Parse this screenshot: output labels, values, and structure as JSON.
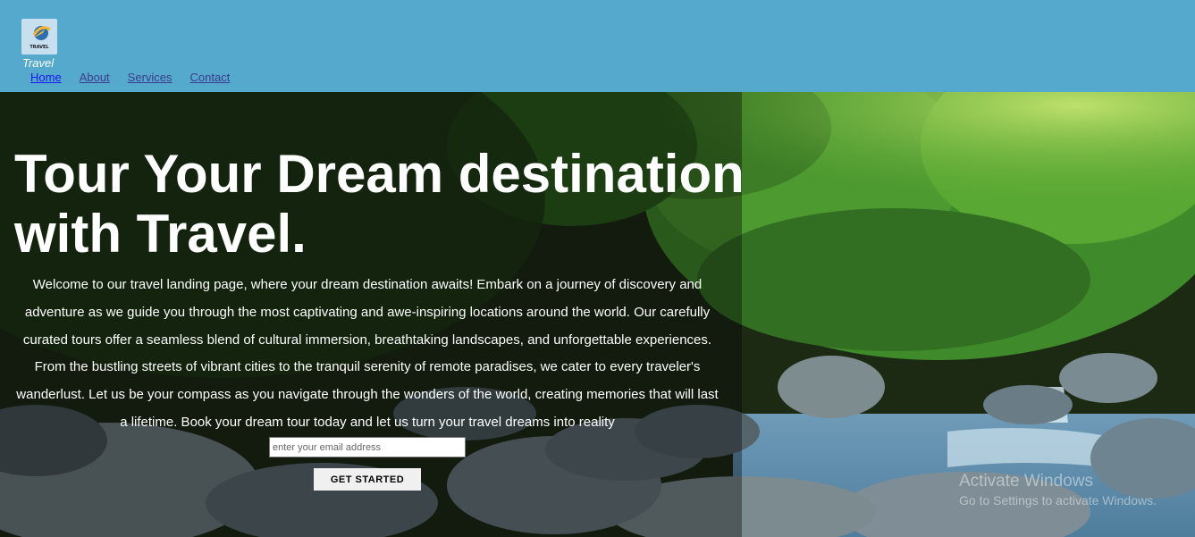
{
  "header": {
    "brand": "Travel",
    "logo_icon": "travel-logo-icon",
    "nav": [
      {
        "label": "Home",
        "active": true
      },
      {
        "label": "About",
        "active": false
      },
      {
        "label": "Services",
        "active": false
      },
      {
        "label": "Contact",
        "active": false
      }
    ]
  },
  "hero": {
    "title": "Tour Your Dream destination with Travel.",
    "description": "Welcome to our travel landing page, where your dream destination awaits! Embark on a journey of discovery and adventure as we guide you through the most captivating and awe-inspiring locations around the world. Our carefully curated tours offer a seamless blend of cultural immersion, breathtaking landscapes, and unforgettable experiences. From the bustling streets of vibrant cities to the tranquil serenity of remote paradises, we cater to every traveler's wanderlust. Let us be your compass as you navigate through the wonders of the world, creating memories that will last a lifetime. Book your dream tour today and let us turn your travel dreams into reality",
    "email_placeholder": "enter your email address",
    "cta_label": "GET STARTED"
  },
  "watermark": {
    "title": "Activate Windows",
    "subtitle": "Go to Settings to activate Windows."
  },
  "colors": {
    "header_bg": "#54a9cc",
    "nav_link": "#3d3d8f",
    "nav_active": "#1a1aee",
    "hero_text": "#ffffff"
  }
}
